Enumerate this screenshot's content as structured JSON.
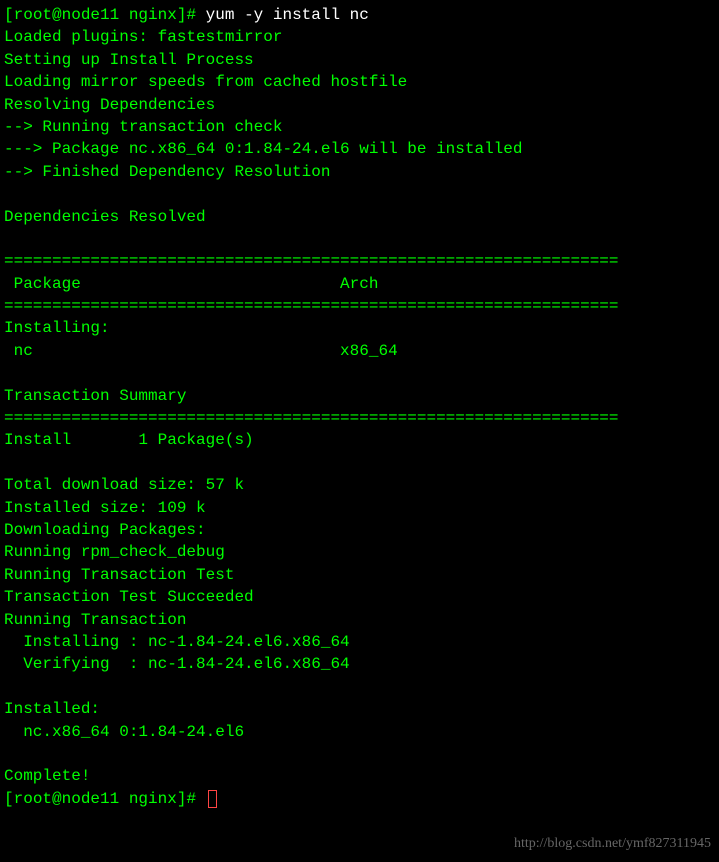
{
  "prompt1": {
    "bracket_open": "[",
    "user_host": "root@node11 nginx",
    "bracket_close": "]#",
    "command": "yum -y install nc"
  },
  "output": {
    "line1": "Loaded plugins: fastestmirror",
    "line2": "Setting up Install Process",
    "line3": "Loading mirror speeds from cached hostfile",
    "line4": "Resolving Dependencies",
    "line5": "--> Running transaction check",
    "line6": "---> Package nc.x86_64 0:1.84-24.el6 will be installed",
    "line7": "--> Finished Dependency Resolution",
    "line8": "Dependencies Resolved",
    "separator": "================================================================",
    "table_header": " Package                           Arch       ",
    "installing_label": "Installing:",
    "package_row": " nc                                x86_64     ",
    "summary_label": "Transaction Summary",
    "install_count": "Install       1 Package(s)",
    "download_size": "Total download size: 57 k",
    "installed_size": "Installed size: 109 k",
    "downloading": "Downloading Packages:",
    "rpm_check": "Running rpm_check_debug",
    "trans_test": "Running Transaction Test",
    "trans_succeed": "Transaction Test Succeeded",
    "running_trans": "Running Transaction",
    "installing_pkg": "  Installing : nc-1.84-24.el6.x86_64           ",
    "verifying_pkg": "  Verifying  : nc-1.84-24.el6.x86_64           ",
    "installed_label": "Installed:",
    "installed_pkg": "  nc.x86_64 0:1.84-24.el6                      ",
    "complete": "Complete!"
  },
  "prompt2": {
    "bracket_open": "[",
    "user_host": "root@node11 nginx",
    "bracket_close": "]#"
  },
  "watermark": "http://blog.csdn.net/ymf827311945"
}
